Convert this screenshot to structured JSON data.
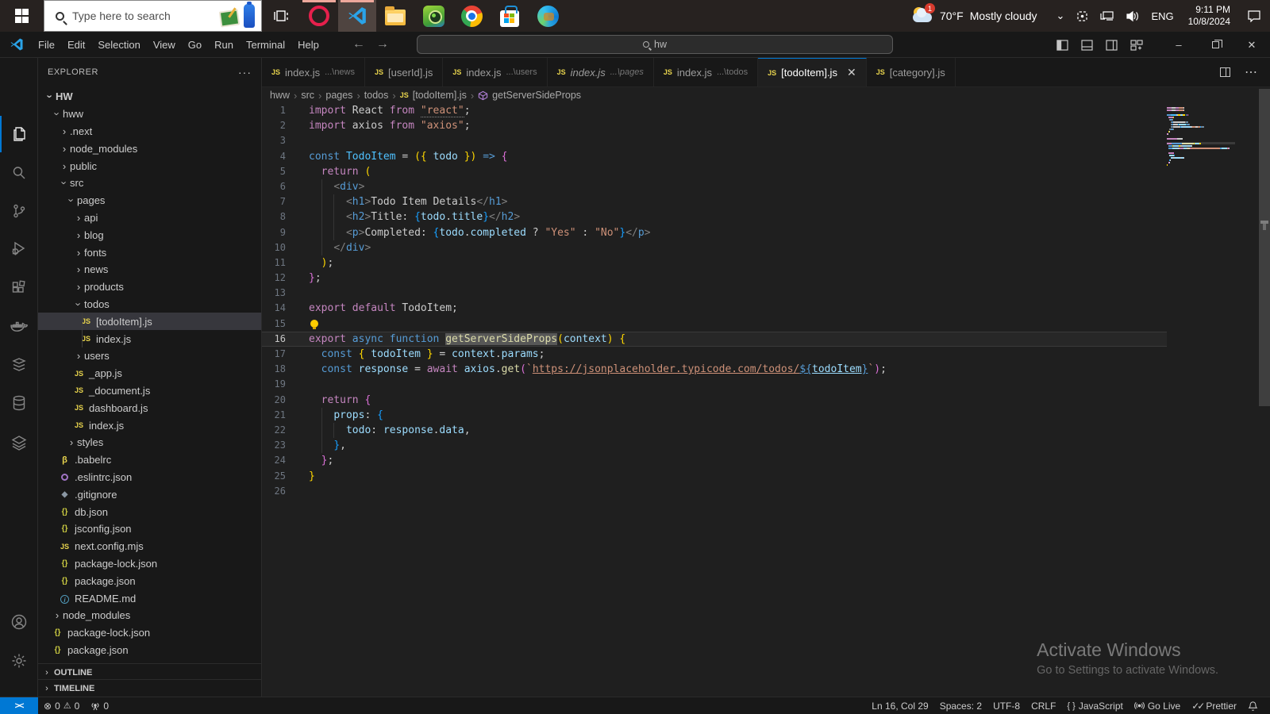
{
  "taskbar": {
    "search_placeholder": "Type here to search",
    "weather": {
      "badge": "1",
      "temp": "70°F",
      "condition": "Mostly cloudy"
    },
    "tray": {
      "language": "ENG",
      "time": "9:11 PM",
      "date": "10/8/2024"
    },
    "pinned_apps": [
      "start",
      "search",
      "task-view",
      "opera",
      "vscode",
      "file-explorer",
      "bluestacks",
      "chrome",
      "microsoft-store",
      "edge"
    ],
    "running_apps": [
      "opera",
      "vscode"
    ]
  },
  "titlebar": {
    "menus": [
      "File",
      "Edit",
      "Selection",
      "View",
      "Go",
      "Run",
      "Terminal",
      "Help"
    ],
    "search_value": "hw",
    "layout_actions": [
      "toggle-primary-sidebar",
      "toggle-panel",
      "toggle-secondary-sidebar",
      "customize-layout"
    ],
    "window_controls": [
      "minimize",
      "restore",
      "close"
    ]
  },
  "tabs": [
    {
      "label": "index.js",
      "desc": "...\\news",
      "active": false,
      "preview": false
    },
    {
      "label": "[userId].js",
      "desc": "",
      "active": false,
      "preview": false
    },
    {
      "label": "index.js",
      "desc": "...\\users",
      "active": false,
      "preview": false
    },
    {
      "label": "index.js",
      "desc": "...\\pages",
      "active": false,
      "preview": true
    },
    {
      "label": "index.js",
      "desc": "...\\todos",
      "active": false,
      "preview": false
    },
    {
      "label": "[todoItem].js",
      "desc": "",
      "active": true,
      "preview": false
    },
    {
      "label": "[category].js",
      "desc": "",
      "active": false,
      "preview": false
    }
  ],
  "tab_actions": [
    "split-editor",
    "more-actions"
  ],
  "breadcrumbs": [
    {
      "label": "hww",
      "icon": null
    },
    {
      "label": "src",
      "icon": null
    },
    {
      "label": "pages",
      "icon": null
    },
    {
      "label": "todos",
      "icon": null
    },
    {
      "label": "[todoItem].js",
      "icon": "js"
    },
    {
      "label": "getServerSideProps",
      "icon": "symbol-method"
    }
  ],
  "explorer": {
    "title": "EXPLORER",
    "more_actions": "···",
    "root": "HW",
    "tree": [
      {
        "label": "HW",
        "level": 0,
        "kind": "root",
        "expanded": true
      },
      {
        "label": "hww",
        "level": 1,
        "kind": "folder",
        "expanded": true
      },
      {
        "label": ".next",
        "level": 2,
        "kind": "folder",
        "expanded": false
      },
      {
        "label": "node_modules",
        "level": 2,
        "kind": "folder",
        "expanded": false
      },
      {
        "label": "public",
        "level": 2,
        "kind": "folder",
        "expanded": false
      },
      {
        "label": "src",
        "level": 2,
        "kind": "folder",
        "expanded": true
      },
      {
        "label": "pages",
        "level": 3,
        "kind": "folder",
        "expanded": true
      },
      {
        "label": "api",
        "level": 4,
        "kind": "folder",
        "expanded": false
      },
      {
        "label": "blog",
        "level": 4,
        "kind": "folder",
        "expanded": false
      },
      {
        "label": "fonts",
        "level": 4,
        "kind": "folder",
        "expanded": false
      },
      {
        "label": "news",
        "level": 4,
        "kind": "folder",
        "expanded": false
      },
      {
        "label": "products",
        "level": 4,
        "kind": "folder",
        "expanded": false
      },
      {
        "label": "todos",
        "level": 4,
        "kind": "folder",
        "expanded": true
      },
      {
        "label": "[todoItem].js",
        "level": 5,
        "kind": "file",
        "icon": "js",
        "selected": true
      },
      {
        "label": "index.js",
        "level": 5,
        "kind": "file",
        "icon": "js"
      },
      {
        "label": "users",
        "level": 4,
        "kind": "folder",
        "expanded": false
      },
      {
        "label": "_app.js",
        "level": 4,
        "kind": "file",
        "icon": "js"
      },
      {
        "label": "_document.js",
        "level": 4,
        "kind": "file",
        "icon": "js"
      },
      {
        "label": "dashboard.js",
        "level": 4,
        "kind": "file",
        "icon": "js"
      },
      {
        "label": "index.js",
        "level": 4,
        "kind": "file",
        "icon": "js"
      },
      {
        "label": "styles",
        "level": 3,
        "kind": "folder",
        "expanded": false
      },
      {
        "label": ".babelrc",
        "level": 2,
        "kind": "file",
        "icon": "babel"
      },
      {
        "label": ".eslintrc.json",
        "level": 2,
        "kind": "file",
        "icon": "eslint"
      },
      {
        "label": ".gitignore",
        "level": 2,
        "kind": "file",
        "icon": "git"
      },
      {
        "label": "db.json",
        "level": 2,
        "kind": "file",
        "icon": "json"
      },
      {
        "label": "jsconfig.json",
        "level": 2,
        "kind": "file",
        "icon": "json"
      },
      {
        "label": "next.config.mjs",
        "level": 2,
        "kind": "file",
        "icon": "js"
      },
      {
        "label": "package-lock.json",
        "level": 2,
        "kind": "file",
        "icon": "json"
      },
      {
        "label": "package.json",
        "level": 2,
        "kind": "file",
        "icon": "json"
      },
      {
        "label": "README.md",
        "level": 2,
        "kind": "file",
        "icon": "info"
      },
      {
        "label": "node_modules",
        "level": 1,
        "kind": "folder",
        "expanded": false
      },
      {
        "label": "package-lock.json",
        "level": 1,
        "kind": "file",
        "icon": "json"
      },
      {
        "label": "package.json",
        "level": 1,
        "kind": "file",
        "icon": "json"
      }
    ],
    "sections": [
      "OUTLINE",
      "TIMELINE"
    ]
  },
  "activity_bar": {
    "top": [
      "explorer",
      "search",
      "source-control",
      "run-and-debug",
      "extensions",
      "docker",
      "database-stack",
      "database",
      "layers"
    ],
    "bottom": [
      "accounts",
      "settings"
    ]
  },
  "code": {
    "lightbulb_line": 15,
    "current_line": 16,
    "lines": [
      {
        "n": 1,
        "segs": [
          [
            "k",
            "import "
          ],
          [
            "w",
            "React "
          ],
          [
            "k",
            "from "
          ],
          [
            "s dots",
            "\"react\""
          ],
          [
            "w",
            ";"
          ]
        ]
      },
      {
        "n": 2,
        "segs": [
          [
            "k",
            "import "
          ],
          [
            "w",
            "axios "
          ],
          [
            "k",
            "from "
          ],
          [
            "s",
            "\"axios\""
          ],
          [
            "w",
            ";"
          ]
        ]
      },
      {
        "n": 3,
        "segs": []
      },
      {
        "n": 4,
        "segs": [
          [
            "d",
            "const "
          ],
          [
            "c",
            "TodoItem"
          ],
          [
            "w",
            " = "
          ],
          [
            "b1",
            "({ "
          ],
          [
            "v",
            "todo"
          ],
          [
            "b1",
            " })"
          ],
          [
            "w",
            " "
          ],
          [
            "d",
            "=>"
          ],
          [
            "w",
            " "
          ],
          [
            "b2",
            "{"
          ]
        ]
      },
      {
        "n": 5,
        "segs": [
          [
            "w",
            "  "
          ],
          [
            "k",
            "return "
          ],
          [
            "b1",
            "("
          ]
        ]
      },
      {
        "n": 6,
        "segs": [
          [
            "w",
            "    "
          ],
          [
            "p",
            "<"
          ],
          [
            "t",
            "div"
          ],
          [
            "p",
            ">"
          ]
        ]
      },
      {
        "n": 7,
        "segs": [
          [
            "w",
            "      "
          ],
          [
            "p",
            "<"
          ],
          [
            "t",
            "h1"
          ],
          [
            "p",
            ">"
          ],
          [
            "w",
            "Todo Item Details"
          ],
          [
            "p",
            "</"
          ],
          [
            "t",
            "h1"
          ],
          [
            "p",
            ">"
          ]
        ]
      },
      {
        "n": 8,
        "segs": [
          [
            "w",
            "      "
          ],
          [
            "p",
            "<"
          ],
          [
            "t",
            "h2"
          ],
          [
            "p",
            ">"
          ],
          [
            "w",
            "Title: "
          ],
          [
            "b3",
            "{"
          ],
          [
            "v",
            "todo"
          ],
          [
            "w",
            "."
          ],
          [
            "v",
            "title"
          ],
          [
            "b3",
            "}"
          ],
          [
            "p",
            "</"
          ],
          [
            "t",
            "h2"
          ],
          [
            "p",
            ">"
          ]
        ]
      },
      {
        "n": 9,
        "segs": [
          [
            "w",
            "      "
          ],
          [
            "p",
            "<"
          ],
          [
            "t",
            "p"
          ],
          [
            "p",
            ">"
          ],
          [
            "w",
            "Completed: "
          ],
          [
            "b3",
            "{"
          ],
          [
            "v",
            "todo"
          ],
          [
            "w",
            "."
          ],
          [
            "v",
            "completed"
          ],
          [
            "w",
            " ? "
          ],
          [
            "s",
            "\"Yes\""
          ],
          [
            "w",
            " : "
          ],
          [
            "s",
            "\"No\""
          ],
          [
            "b3",
            "}"
          ],
          [
            "p",
            "</"
          ],
          [
            "t",
            "p"
          ],
          [
            "p",
            ">"
          ]
        ]
      },
      {
        "n": 10,
        "segs": [
          [
            "w",
            "    "
          ],
          [
            "p",
            "</"
          ],
          [
            "t",
            "div"
          ],
          [
            "p",
            ">"
          ]
        ]
      },
      {
        "n": 11,
        "segs": [
          [
            "w",
            "  "
          ],
          [
            "b1",
            ")"
          ],
          [
            "w",
            ";"
          ]
        ]
      },
      {
        "n": 12,
        "segs": [
          [
            "b2",
            "}"
          ],
          [
            "w",
            ";"
          ]
        ]
      },
      {
        "n": 13,
        "segs": []
      },
      {
        "n": 14,
        "segs": [
          [
            "k",
            "export default "
          ],
          [
            "w",
            "TodoItem;"
          ]
        ]
      },
      {
        "n": 15,
        "segs": []
      },
      {
        "n": 16,
        "segs": [
          [
            "k",
            "export "
          ],
          [
            "d",
            "async "
          ],
          [
            "d",
            "function "
          ],
          [
            "f hl",
            "getServerSideProps"
          ],
          [
            "b1",
            "("
          ],
          [
            "v",
            "context"
          ],
          [
            "b1",
            ")"
          ],
          [
            "w",
            " "
          ],
          [
            "b1",
            "{"
          ]
        ]
      },
      {
        "n": 17,
        "segs": [
          [
            "w",
            "  "
          ],
          [
            "d",
            "const "
          ],
          [
            "b1",
            "{ "
          ],
          [
            "v",
            "todoItem"
          ],
          [
            "b1",
            " }"
          ],
          [
            "w",
            " = "
          ],
          [
            "v",
            "context"
          ],
          [
            "w",
            "."
          ],
          [
            "v",
            "params"
          ],
          [
            "w",
            ";"
          ]
        ]
      },
      {
        "n": 18,
        "segs": [
          [
            "w",
            "  "
          ],
          [
            "d",
            "const "
          ],
          [
            "v",
            "response"
          ],
          [
            "w",
            " = "
          ],
          [
            "k",
            "await "
          ],
          [
            "v",
            "axios"
          ],
          [
            "w",
            "."
          ],
          [
            "f",
            "get"
          ],
          [
            "b2",
            "("
          ],
          [
            "s",
            "`"
          ],
          [
            "s lnk",
            "https://jsonplaceholder.typicode.com/todos/"
          ],
          [
            "d lnk",
            "${"
          ],
          [
            "v lnk",
            "todoItem"
          ],
          [
            "d lnk",
            "}"
          ],
          [
            "s",
            "`"
          ],
          [
            "b2",
            ")"
          ],
          [
            "w",
            ";"
          ]
        ]
      },
      {
        "n": 19,
        "segs": []
      },
      {
        "n": 20,
        "segs": [
          [
            "w",
            "  "
          ],
          [
            "k",
            "return "
          ],
          [
            "b2",
            "{"
          ]
        ]
      },
      {
        "n": 21,
        "segs": [
          [
            "w",
            "    "
          ],
          [
            "v",
            "props"
          ],
          [
            "w",
            ": "
          ],
          [
            "b3",
            "{"
          ]
        ]
      },
      {
        "n": 22,
        "segs": [
          [
            "w",
            "      "
          ],
          [
            "v",
            "todo"
          ],
          [
            "w",
            ": "
          ],
          [
            "v",
            "response"
          ],
          [
            "w",
            "."
          ],
          [
            "v",
            "data"
          ],
          [
            "w",
            ","
          ]
        ]
      },
      {
        "n": 23,
        "segs": [
          [
            "w",
            "    "
          ],
          [
            "b3",
            "}"
          ],
          [
            "w",
            ","
          ]
        ]
      },
      {
        "n": 24,
        "segs": [
          [
            "w",
            "  "
          ],
          [
            "b2",
            "}"
          ],
          [
            "w",
            ";"
          ]
        ]
      },
      {
        "n": 25,
        "segs": [
          [
            "b1",
            "}"
          ]
        ]
      },
      {
        "n": 26,
        "segs": []
      }
    ]
  },
  "status_bar": {
    "remote_label": "><",
    "problems": {
      "errors": "0",
      "warnings": "0",
      "ports": "0"
    },
    "right_items": [
      {
        "id": "cursor-position",
        "label": "Ln 16, Col 29",
        "icon": null
      },
      {
        "id": "indentation",
        "label": "Spaces: 2",
        "icon": null
      },
      {
        "id": "encoding",
        "label": "UTF-8",
        "icon": null
      },
      {
        "id": "eol",
        "label": "CRLF",
        "icon": null
      },
      {
        "id": "language-mode",
        "label": "JavaScript",
        "icon": "braces"
      },
      {
        "id": "go-live",
        "label": "Go Live",
        "icon": "broadcast"
      },
      {
        "id": "prettier",
        "label": "Prettier",
        "icon": "double-check"
      },
      {
        "id": "notifications",
        "label": "",
        "icon": "bell"
      }
    ]
  },
  "watermark": {
    "line1": "Activate Windows",
    "line2": "Go to Settings to activate Windows."
  }
}
